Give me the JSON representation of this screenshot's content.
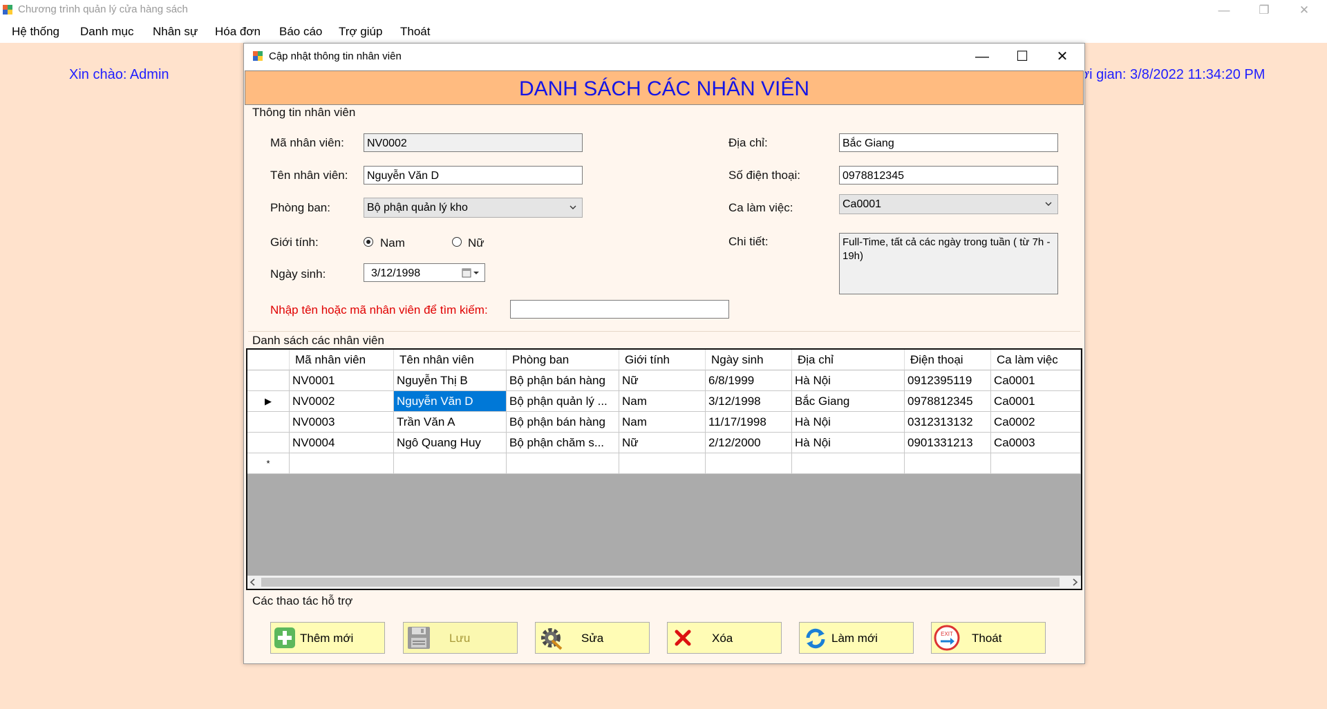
{
  "app": {
    "title": "Chương trình quản lý cửa hàng sách",
    "window_controls": {
      "minimize": "—",
      "restore": "❐",
      "close": "✕"
    }
  },
  "menu": [
    "Hệ thống",
    "Danh mục",
    "Nhân sự",
    "Hóa đơn",
    "Báo cáo",
    "Trợ giúp",
    "Thoát"
  ],
  "greeting": "Xin chào: Admin",
  "clock": "ời gian: 3/8/2022 11:34:20 PM",
  "dialog": {
    "title": "Cập nhật thông tin nhân viên",
    "controls": {
      "minimize": "—",
      "maximize": "☐",
      "close": "✕"
    },
    "banner": "DANH SÁCH CÁC NHÂN VIÊN"
  },
  "info": {
    "group_title": "Thông tin nhân viên",
    "ma_label": "Mã nhân viên:",
    "ma_value": "NV0002",
    "ten_label": "Tên nhân viên:",
    "ten_value": "Nguyễn Văn D",
    "phong_label": "Phòng ban:",
    "phong_value": "Bộ phận quản lý kho",
    "gioitinh_label": "Giới tính:",
    "gender_male": "Nam",
    "gender_female": "Nữ",
    "gender_selected": "Nam",
    "ngaysinh_label": "Ngày sinh:",
    "ngaysinh_value": "3/12/1998",
    "diachi_label": "Địa chỉ:",
    "diachi_value": "Bắc Giang",
    "sdt_label": "Số điện thoại:",
    "sdt_value": "0978812345",
    "ca_label": "Ca làm việc:",
    "ca_value": "Ca0001",
    "chitiet_label": "Chi tiết:",
    "chitiet_value": "Full-Time, tất cả các ngày trong tuần ( từ 7h - 19h)",
    "search_label": "Nhập tên hoặc mã nhân viên để tìm kiếm:",
    "search_value": ""
  },
  "list": {
    "group_title": "Danh sách các nhân viên",
    "columns": [
      "Mã nhân viên",
      "Tên nhân viên",
      "Phòng ban",
      "Giới tính",
      "Ngày sinh",
      "Địa chỉ",
      "Điện thoại",
      "Ca làm việc"
    ],
    "rows": [
      [
        "NV0001",
        "Nguyễn Thị B",
        "Bộ phận bán hàng",
        "Nữ",
        "6/8/1999",
        "Hà Nội",
        "0912395119",
        "Ca0001"
      ],
      [
        "NV0002",
        "Nguyễn Văn D",
        "Bộ phận quản lý ...",
        "Nam",
        "3/12/1998",
        "Bắc Giang",
        "0978812345",
        "Ca0001"
      ],
      [
        "NV0003",
        "Trần Văn A",
        "Bộ phận bán hàng",
        "Nam",
        "11/17/1998",
        "Hà Nội",
        "0312313132",
        "Ca0002"
      ],
      [
        "NV0004",
        "Ngô Quang Huy",
        "Bộ phận chăm s...",
        "Nữ",
        "2/12/2000",
        "Hà Nội",
        "0901331213",
        "Ca0003"
      ]
    ],
    "selected_row_marker": "▶",
    "new_row_marker": "*"
  },
  "actions": {
    "group_title": "Các thao tác hỗ trợ",
    "add": "Thêm mới",
    "save": "Lưu",
    "edit": "Sửa",
    "delete": "Xóa",
    "refresh": "Làm mới",
    "exit": "Thoát",
    "exit_icon_text": "EXIT"
  }
}
